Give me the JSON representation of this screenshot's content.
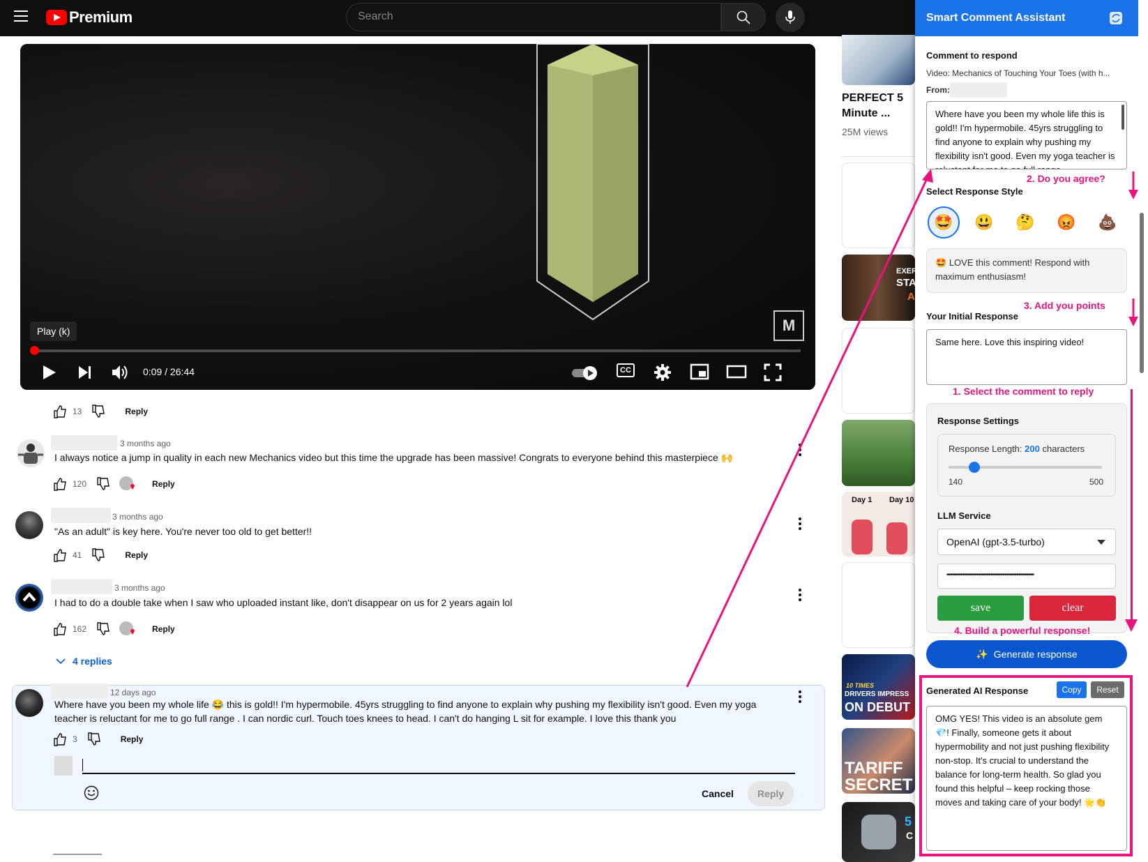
{
  "topbar": {
    "logo": "Premium",
    "search_placeholder": "Search"
  },
  "player": {
    "tooltip": "Play (k)",
    "time": "0:09 / 26:44",
    "badge": "M",
    "cc": "CC"
  },
  "comments": [
    {
      "likes": "13",
      "reply": "Reply"
    },
    {
      "time": "3 months ago",
      "text": "I always notice a jump in quality in each new Mechanics video but this time the upgrade has been massive! Congrats to everyone behind this masterpiece 🙌",
      "likes": "120",
      "reply": "Reply"
    },
    {
      "time": "3 months ago",
      "text": "\"As an adult\" is key here. You're never too old to get better!!",
      "likes": "41",
      "reply": "Reply"
    },
    {
      "time": "3 months ago",
      "text": "I had to do a double take when I saw who uploaded instant like, don't disappear on us for 2 years again lol",
      "likes": "162",
      "reply": "Reply"
    },
    {
      "replies_label": "4 replies"
    },
    {
      "time": "12 days ago",
      "text": "Where have you been my whole life 😂 this is gold!! I'm hypermobile. 45yrs struggling to find anyone to explain why pushing my flexibility isn't good. Even my yoga teacher is reluctant for me to go full range . I can nordic curl. Touch toes knees to head. I can't do hanging L sit for example. I love this thank you",
      "likes": "3",
      "reply": "Reply",
      "cancel": "Cancel",
      "reply_btn": "Reply"
    }
  ],
  "sidebar": {
    "video1": {
      "title_line1": "PERFECT 5",
      "title_line2": "Minute ...",
      "views": "25M views"
    },
    "thumb_texts": {
      "exer": "EXERC",
      "stay": "STAY",
      "ap": "AP",
      "day1": "Day 1",
      "day10": "Day 10",
      "tariff1": "TARIFF",
      "tariff2": "SECRET",
      "drivers": "DRIVERS IMPRESS",
      "debut": "ON DEBUT",
      "times": "10 TIMES",
      "five": "5",
      "c": "C"
    }
  },
  "panel": {
    "title": "Smart Comment Assistant",
    "comment_label": "Comment to respond",
    "video_line": "Video: Mechanics of Touching Your Toes (with h...",
    "from_label": "From:",
    "comment_text": "Where have you been my whole life  this is gold!! I'm hypermobile. 45yrs struggling to find anyone to explain why pushing my flexibility isn't good. Even my yoga teacher is reluctant for me to go full range.",
    "step2": "2. Do you agree?",
    "style_label": "Select Response Style",
    "emojis": [
      "🤩",
      "😃",
      "🤔",
      "😡",
      "💩"
    ],
    "style_desc_emoji": "🤩",
    "style_desc": "LOVE this comment! Respond with maximum enthusiasm!",
    "step3": "3. Add you points",
    "initial_label": "Your Initial Response",
    "initial_text": "Same here. Love this inspiring video!",
    "step1": "1. Select the comment to reply",
    "settings_label": "Response Settings",
    "length_label": "Response Length:",
    "length_value": "200",
    "length_unit": "characters",
    "slider_value": 200,
    "slider_min": "140",
    "slider_max": "500",
    "llm_label": "LLM Service",
    "llm_value": "OpenAI (gpt-3.5-turbo)",
    "api_key": "••••••••••••••••••••••••••••••••••••••••••••••••••",
    "save": "save",
    "clear": "clear",
    "step4": "4. Build a powerful response!",
    "generate": "Generate response",
    "generated_label": "Generated AI Response",
    "copy": "Copy",
    "reset": "Reset",
    "generated_text": "OMG YES! This video is an absolute gem 💎! Finally, someone gets it about hypermobility and not just pushing flexibility non-stop. It's crucial to understand the balance for long-term health. So glad you found this helpful – keep rocking those moves and taking care of your body! 🌟👏"
  },
  "colors": {
    "accent": "#1a73e8",
    "pink": "#e8147d",
    "save": "#2a9d3f",
    "clear": "#d9263a",
    "generate": "#0b57d0"
  }
}
